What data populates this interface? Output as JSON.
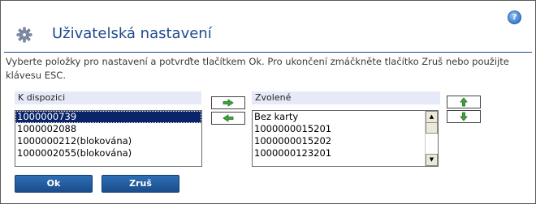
{
  "header": {
    "title": "Uživatelská nastavení",
    "help_label": "?"
  },
  "instructions": "Vyberte položky pro nastavení a potvrďte tlačítkem Ok. Pro ukončení zmáčkněte tlačítko Zruš nebo použijte klávesu ESC.",
  "available": {
    "label": "K dispozici",
    "items": [
      "1000000739",
      "1000002088",
      "1000000212(blokována)",
      "1000002055(blokována)"
    ]
  },
  "selected": {
    "label": "Zvolené",
    "items": [
      "Bez karty",
      "1000000015201",
      "1000000015202",
      "1000000123201"
    ]
  },
  "buttons": {
    "ok": "Ok",
    "cancel": "Zruš"
  },
  "colors": {
    "accent": "#1f4a8f",
    "selection": "#0a246a",
    "button": "#1a4d8c",
    "arrow": "#2e9b2e"
  },
  "icons": {
    "title": "gear-icon",
    "help": "help-icon",
    "move_right": "arrow-right-icon",
    "move_left": "arrow-left-icon",
    "move_up": "arrow-up-icon",
    "move_down": "arrow-down-icon"
  }
}
